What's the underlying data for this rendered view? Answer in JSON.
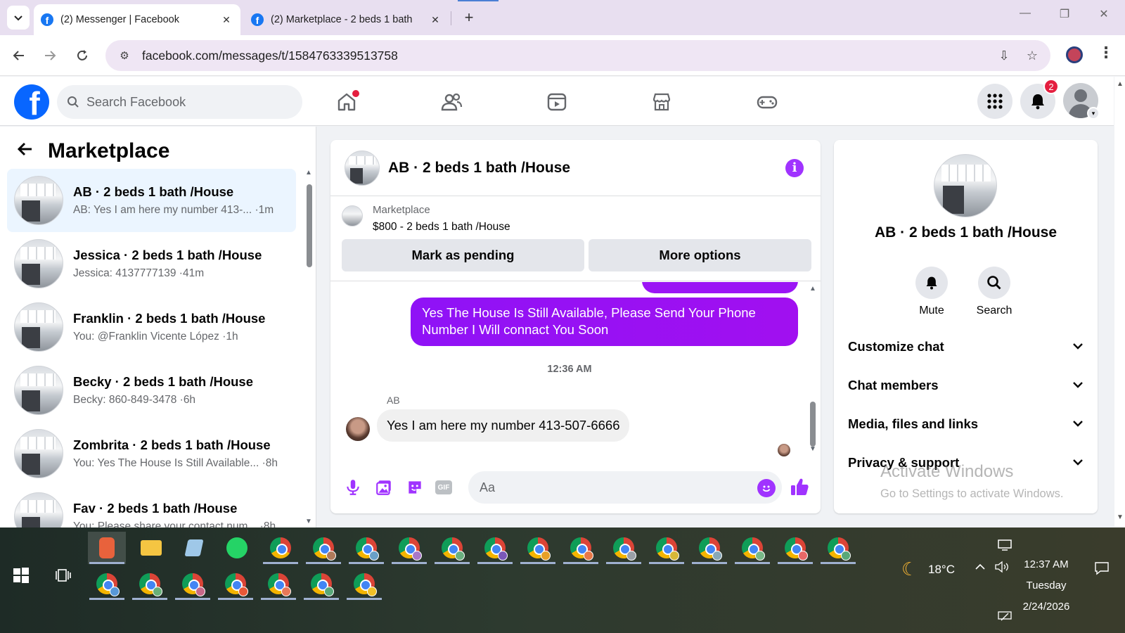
{
  "browser": {
    "tabs": [
      {
        "title": "(2) Messenger | Facebook",
        "active": true
      },
      {
        "title": "(2) Marketplace - 2 beds 1 bath",
        "active": false
      }
    ],
    "url": "facebook.com/messages/t/1584763339513758"
  },
  "fb": {
    "search_placeholder": "Search Facebook",
    "notification_count": "2",
    "nav": [
      "home-icon",
      "friends-icon",
      "video-icon",
      "marketplace-icon",
      "gaming-icon"
    ]
  },
  "sidebar": {
    "title": "Marketplace",
    "conversations": [
      {
        "name": "AB · 2 beds 1 bath /House",
        "snippet": "AB: Yes I am here my number 413-... ·1m",
        "active": true
      },
      {
        "name": "Jessica · 2 beds 1 bath /House",
        "snippet": "Jessica: 4137777139 ·41m"
      },
      {
        "name": "Franklin · 2 beds 1 bath /House",
        "snippet": "You: @Franklin Vicente López ·1h"
      },
      {
        "name": "Becky · 2 beds 1 bath /House",
        "snippet": "Becky: 860-849-3478 ·6h"
      },
      {
        "name": "Zombrita · 2 beds 1 bath /House",
        "snippet": "You: Yes The House Is Still Available... ·8h"
      },
      {
        "name": "Fav · 2 beds 1 bath /House",
        "snippet": "You: Please share your contact num... ·8h"
      }
    ]
  },
  "chat": {
    "title": "AB · 2 beds 1 bath /House",
    "listing_label": "Marketplace",
    "listing_price": "$800 - 2 beds 1 bath /House",
    "mark_pending_label": "Mark as pending",
    "more_options_label": "More options",
    "outgoing_message": "Yes The House Is Still Available, Please Send Your Phone Number I Will connact You Soon",
    "timestamp": "12:36 AM",
    "sender": "AB",
    "incoming_message": "Yes I am here my number 413-507-6666",
    "input_placeholder": "Aa",
    "accent": "#a033ff"
  },
  "info_panel": {
    "name": "AB · 2 beds 1 bath /House",
    "mute_label": "Mute",
    "search_label": "Search",
    "sections": [
      "Customize chat",
      "Chat members",
      "Media, files and links",
      "Privacy & support"
    ]
  },
  "watermark": {
    "line1": "Activate Windows",
    "line2": "Go to Settings to activate Windows."
  },
  "taskbar": {
    "weather": "18°C",
    "time": "12:37 AM",
    "day": "Tuesday",
    "date": "2/24/2026"
  }
}
